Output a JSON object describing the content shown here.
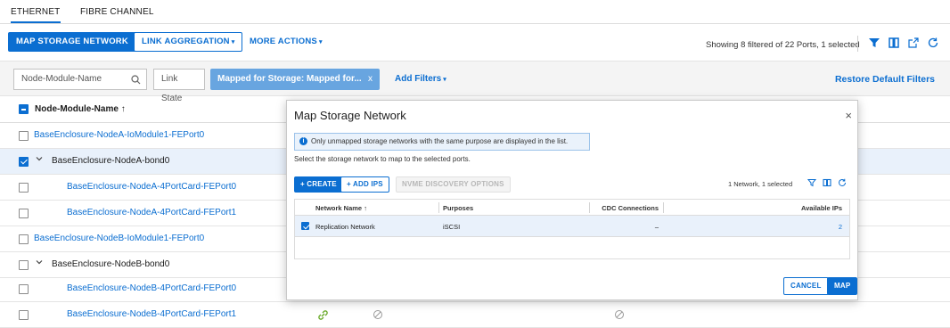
{
  "tabs": [
    {
      "label": "ETHERNET"
    },
    {
      "label": "FIBRE CHANNEL"
    }
  ],
  "toolbar": {
    "map_storage_network": "MAP STORAGE NETWORK",
    "link_aggregation": "LINK AGGREGATION",
    "more_actions": "MORE ACTIONS",
    "showing": "Showing 8 filtered of 22 Ports, 1 selected",
    "caret": "▾"
  },
  "filters": {
    "search_placeholder": "Node-Module-Name",
    "link_state": "Link State",
    "chip": "Mapped for Storage: Mapped for...",
    "chip_close": "x",
    "add_filters": "Add Filters",
    "restore": "Restore Default Filters"
  },
  "grid": {
    "header": "Node-Module-Name",
    "sort_arrow": "↑",
    "rows": [
      {
        "name": "BaseEnclosure-NodeA-IoModule1-FEPort0"
      },
      {
        "name": "BaseEnclosure-NodeA-bond0"
      },
      {
        "name": "BaseEnclosure-NodeA-4PortCard-FEPort0"
      },
      {
        "name": "BaseEnclosure-NodeA-4PortCard-FEPort1"
      },
      {
        "name": "BaseEnclosure-NodeB-IoModule1-FEPort0"
      },
      {
        "name": "BaseEnclosure-NodeB-bond0"
      },
      {
        "name": "BaseEnclosure-NodeB-4PortCard-FEPort0"
      },
      {
        "name": "BaseEnclosure-NodeB-4PortCard-FEPort1"
      }
    ]
  },
  "modal": {
    "title": "Map Storage Network",
    "close": "×",
    "info": "Only unmapped storage networks with the same purpose are displayed in the list.",
    "instruction": "Select the storage network to map to the selected ports.",
    "create": "+ CREATE",
    "add_ips": "+ ADD IPS",
    "nvme": "NVME DISCOVERY OPTIONS",
    "count": "1 Network, 1 selected",
    "table": {
      "headers": {
        "network_name": "Network Name",
        "purposes": "Purposes",
        "cdc": "CDC Connections",
        "available_ips": "Available IPs"
      },
      "row": {
        "network_name": "Replication Network",
        "purposes": "iSCSI",
        "cdc": "–",
        "available_ips": "2"
      }
    },
    "cancel": "CANCEL",
    "map": "MAP"
  },
  "colors": {
    "accent": "#0b6ed1",
    "selected_row": "#e9f1fb",
    "chip": "#68a5e0",
    "link_icon": "#6aaa2a"
  }
}
